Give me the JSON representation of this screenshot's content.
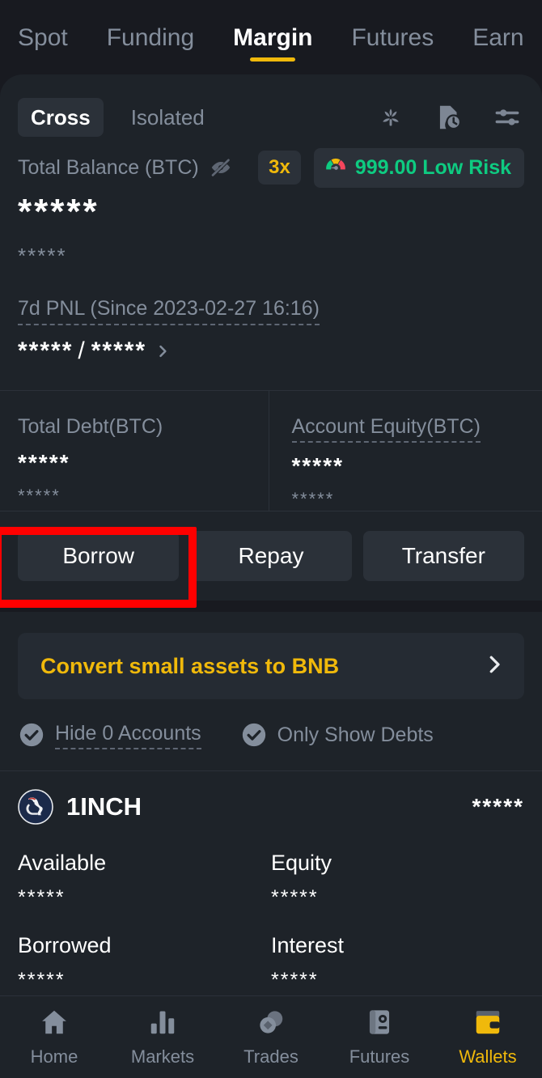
{
  "theme": {
    "page_bg": "#181a20",
    "card_bg": "#1e2329",
    "accent": "#f0b90b",
    "positive": "#0ecb81",
    "muted_text": "#848e9c",
    "highlight_box": "#ff0000"
  },
  "topnav": {
    "tabs": [
      {
        "label": "Spot",
        "active": false
      },
      {
        "label": "Funding",
        "active": false
      },
      {
        "label": "Margin",
        "active": true
      },
      {
        "label": "Futures",
        "active": false
      },
      {
        "label": "Earn",
        "active": false
      }
    ]
  },
  "mode": {
    "cross_label": "Cross",
    "isolated_label": "Isolated",
    "icons": [
      "flower-icon",
      "history-document-icon",
      "settings-sliders-icon"
    ]
  },
  "balance": {
    "label": "Total Balance (BTC)",
    "hide_icon": "eye-off-icon",
    "leverage_badge": "3x",
    "risk_value": "999.00 Low Risk",
    "risk_icon": "risk-gauge-icon",
    "masked_amount": "*****",
    "masked_fiat": "*****"
  },
  "pnl": {
    "label": "7d PNL (Since 2023-02-27 16:16)",
    "value": "*****",
    "separator": "/",
    "percent": "*****",
    "chevron": "chevron-right-icon"
  },
  "stats": [
    {
      "label": "Total Debt(BTC)",
      "value": "*****",
      "sub": "*****",
      "dashed": false
    },
    {
      "label": "Account Equity(BTC)",
      "value": "*****",
      "sub": "*****",
      "dashed": true
    }
  ],
  "actions": [
    {
      "label": "Borrow",
      "highlighted": true
    },
    {
      "label": "Repay",
      "highlighted": false
    },
    {
      "label": "Transfer",
      "highlighted": false
    }
  ],
  "convert": {
    "label": "Convert small assets to BNB",
    "chevron": "chevron-right-icon"
  },
  "filters": [
    {
      "label": "Hide 0 Accounts",
      "checked": true,
      "dashed": true
    },
    {
      "label": "Only Show Debts",
      "checked": true,
      "dashed": false
    }
  ],
  "asset": {
    "symbol": "1INCH",
    "logo": "1inch-coin-icon",
    "total": "*****",
    "fields": [
      {
        "label": "Available",
        "value": "*****"
      },
      {
        "label": "Equity",
        "value": "*****"
      },
      {
        "label": "Borrowed",
        "value": "*****"
      },
      {
        "label": "Interest",
        "value": "*****"
      }
    ]
  },
  "bottomnav": {
    "items": [
      {
        "label": "Home",
        "icon": "home-icon",
        "active": false
      },
      {
        "label": "Markets",
        "icon": "bar-chart-icon",
        "active": false
      },
      {
        "label": "Trades",
        "icon": "trades-circles-icon",
        "active": false
      },
      {
        "label": "Futures",
        "icon": "futures-card-icon",
        "active": false
      },
      {
        "label": "Wallets",
        "icon": "wallet-icon",
        "active": true
      }
    ]
  }
}
